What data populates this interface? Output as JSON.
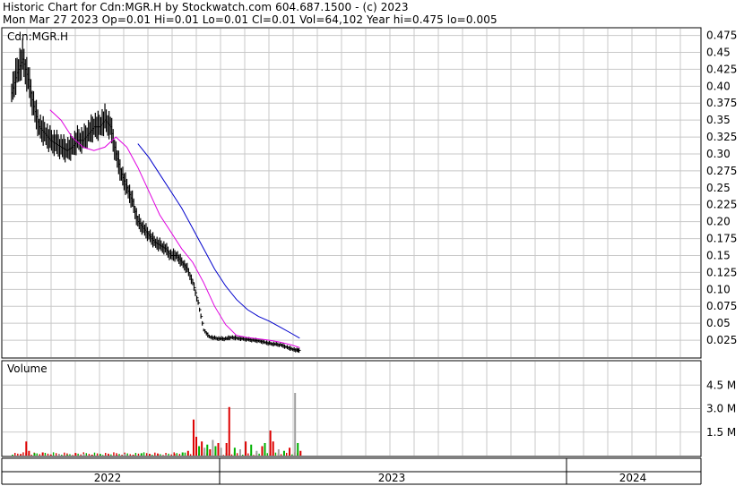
{
  "header": {
    "line1": "Historic Chart for Cdn:MGR.H by Stockwatch.com 604.687.1500 - (c) 2023",
    "line2": "Mon Mar 27 2023  Op=0.01  Hi=0.01  Lo=0.01  Cl=0.01  Vol=64,102  Year hi=0.475  lo=0.005"
  },
  "symbol_label": "Cdn:MGR.H",
  "volume_label": "Volume",
  "colors": {
    "ma_short": "#e000e0",
    "ma_long": "#0000cc",
    "bar": "#000000",
    "vol_up": "#00b000",
    "vol_down": "#dd0000",
    "vol_flat": "#a0a0a0",
    "grid": "#c8c8c8"
  },
  "chart_data": [
    {
      "type": "line",
      "title": "",
      "y_ticks": [
        "0.475",
        "0.45",
        "0.425",
        "0.40",
        "0.375",
        "0.35",
        "0.325",
        "0.30",
        "0.275",
        "0.25",
        "0.225",
        "0.20",
        "0.175",
        "0.15",
        "0.125",
        "0.10",
        "0.075",
        "0.05",
        "0.025"
      ],
      "ylim": [
        0,
        0.485
      ],
      "x_labels": [
        "2022",
        "2023",
        "2024"
      ],
      "series": [
        {
          "key": "price",
          "points": [
            [
              0,
              0.39
            ],
            [
              4,
              0.42
            ],
            [
              8,
              0.44
            ],
            [
              12,
              0.41
            ],
            [
              16,
              0.37
            ],
            [
              20,
              0.34
            ],
            [
              24,
              0.33
            ],
            [
              28,
              0.32
            ],
            [
              32,
              0.315
            ],
            [
              36,
              0.31
            ],
            [
              40,
              0.305
            ],
            [
              44,
              0.31
            ],
            [
              48,
              0.32
            ],
            [
              52,
              0.32
            ],
            [
              56,
              0.33
            ],
            [
              60,
              0.34
            ],
            [
              64,
              0.34
            ],
            [
              68,
              0.35
            ],
            [
              72,
              0.34
            ],
            [
              76,
              0.3
            ],
            [
              80,
              0.27
            ],
            [
              84,
              0.25
            ],
            [
              88,
              0.23
            ],
            [
              92,
              0.2
            ],
            [
              96,
              0.19
            ],
            [
              100,
              0.18
            ],
            [
              104,
              0.17
            ],
            [
              108,
              0.165
            ],
            [
              112,
              0.16
            ],
            [
              116,
              0.15
            ],
            [
              120,
              0.15
            ],
            [
              124,
              0.14
            ],
            [
              128,
              0.13
            ],
            [
              132,
              0.11
            ],
            [
              136,
              0.08
            ],
            [
              140,
              0.04
            ],
            [
              144,
              0.03
            ],
            [
              148,
              0.028
            ],
            [
              152,
              0.027
            ],
            [
              156,
              0.027
            ],
            [
              160,
              0.029
            ],
            [
              164,
              0.028
            ],
            [
              168,
              0.027
            ],
            [
              172,
              0.026
            ],
            [
              176,
              0.025
            ],
            [
              180,
              0.024
            ],
            [
              184,
              0.022
            ],
            [
              188,
              0.02
            ],
            [
              192,
              0.019
            ],
            [
              196,
              0.018
            ],
            [
              200,
              0.015
            ],
            [
              204,
              0.012
            ],
            [
              208,
              0.01
            ],
            [
              210,
              0.01
            ]
          ]
        },
        {
          "key": "ma_short",
          "points": [
            [
              28,
              0.365
            ],
            [
              36,
              0.35
            ],
            [
              44,
              0.325
            ],
            [
              52,
              0.31
            ],
            [
              60,
              0.305
            ],
            [
              68,
              0.31
            ],
            [
              76,
              0.325
            ],
            [
              84,
              0.31
            ],
            [
              92,
              0.28
            ],
            [
              100,
              0.245
            ],
            [
              108,
              0.21
            ],
            [
              116,
              0.185
            ],
            [
              124,
              0.16
            ],
            [
              132,
              0.14
            ],
            [
              140,
              0.11
            ],
            [
              148,
              0.075
            ],
            [
              156,
              0.048
            ],
            [
              164,
              0.032
            ],
            [
              172,
              0.029
            ],
            [
              180,
              0.027
            ],
            [
              188,
              0.025
            ],
            [
              196,
              0.022
            ],
            [
              204,
              0.018
            ],
            [
              210,
              0.014
            ]
          ]
        },
        {
          "key": "ma_long",
          "points": [
            [
              92,
              0.315
            ],
            [
              100,
              0.295
            ],
            [
              108,
              0.27
            ],
            [
              116,
              0.245
            ],
            [
              124,
              0.22
            ],
            [
              132,
              0.19
            ],
            [
              140,
              0.16
            ],
            [
              148,
              0.13
            ],
            [
              156,
              0.105
            ],
            [
              164,
              0.085
            ],
            [
              172,
              0.07
            ],
            [
              180,
              0.06
            ],
            [
              188,
              0.053
            ],
            [
              196,
              0.044
            ],
            [
              204,
              0.035
            ],
            [
              210,
              0.028
            ]
          ]
        }
      ]
    },
    {
      "type": "bar",
      "title": "",
      "y_ticks": [
        "4.5 M",
        "3.0 M",
        "1.5 M"
      ],
      "ylim": [
        0,
        6.0
      ],
      "values": [
        [
          0,
          0.05,
          "u"
        ],
        [
          6,
          0.1,
          "d"
        ],
        [
          10,
          0.9,
          "d"
        ],
        [
          12,
          0.3,
          "d"
        ],
        [
          16,
          0.15,
          "u"
        ],
        [
          22,
          0.2,
          "d"
        ],
        [
          28,
          0.05,
          "d"
        ],
        [
          34,
          0.1,
          "f"
        ],
        [
          40,
          0.05,
          "u"
        ],
        [
          46,
          0.15,
          "d"
        ],
        [
          52,
          0.1,
          "f"
        ],
        [
          58,
          0.05,
          "d"
        ],
        [
          64,
          0.1,
          "u"
        ],
        [
          70,
          0.08,
          "d"
        ],
        [
          76,
          0.05,
          "d"
        ],
        [
          82,
          0.1,
          "f"
        ],
        [
          88,
          0.05,
          "d"
        ],
        [
          94,
          0.15,
          "u"
        ],
        [
          100,
          0.1,
          "d"
        ],
        [
          106,
          0.1,
          "d"
        ],
        [
          112,
          0.05,
          "f"
        ],
        [
          118,
          0.12,
          "d"
        ],
        [
          124,
          0.2,
          "u"
        ],
        [
          128,
          0.3,
          "d"
        ],
        [
          132,
          2.3,
          "d"
        ],
        [
          134,
          1.2,
          "d"
        ],
        [
          136,
          0.6,
          "u"
        ],
        [
          138,
          0.9,
          "d"
        ],
        [
          140,
          0.5,
          "f"
        ],
        [
          142,
          0.7,
          "u"
        ],
        [
          144,
          0.4,
          "d"
        ],
        [
          146,
          1.0,
          "f"
        ],
        [
          148,
          0.6,
          "u"
        ],
        [
          150,
          0.8,
          "d"
        ],
        [
          152,
          0.5,
          "f"
        ],
        [
          156,
          0.8,
          "d"
        ],
        [
          158,
          3.1,
          "d"
        ],
        [
          162,
          0.5,
          "u"
        ],
        [
          166,
          0.4,
          "f"
        ],
        [
          170,
          0.9,
          "d"
        ],
        [
          174,
          0.7,
          "u"
        ],
        [
          178,
          0.3,
          "f"
        ],
        [
          182,
          0.6,
          "d"
        ],
        [
          184,
          0.8,
          "u"
        ],
        [
          188,
          1.6,
          "d"
        ],
        [
          190,
          0.9,
          "d"
        ],
        [
          194,
          0.4,
          "f"
        ],
        [
          198,
          0.3,
          "u"
        ],
        [
          202,
          0.5,
          "d"
        ],
        [
          206,
          4.0,
          "f"
        ],
        [
          208,
          0.8,
          "u"
        ],
        [
          210,
          0.3,
          "d"
        ]
      ]
    }
  ]
}
